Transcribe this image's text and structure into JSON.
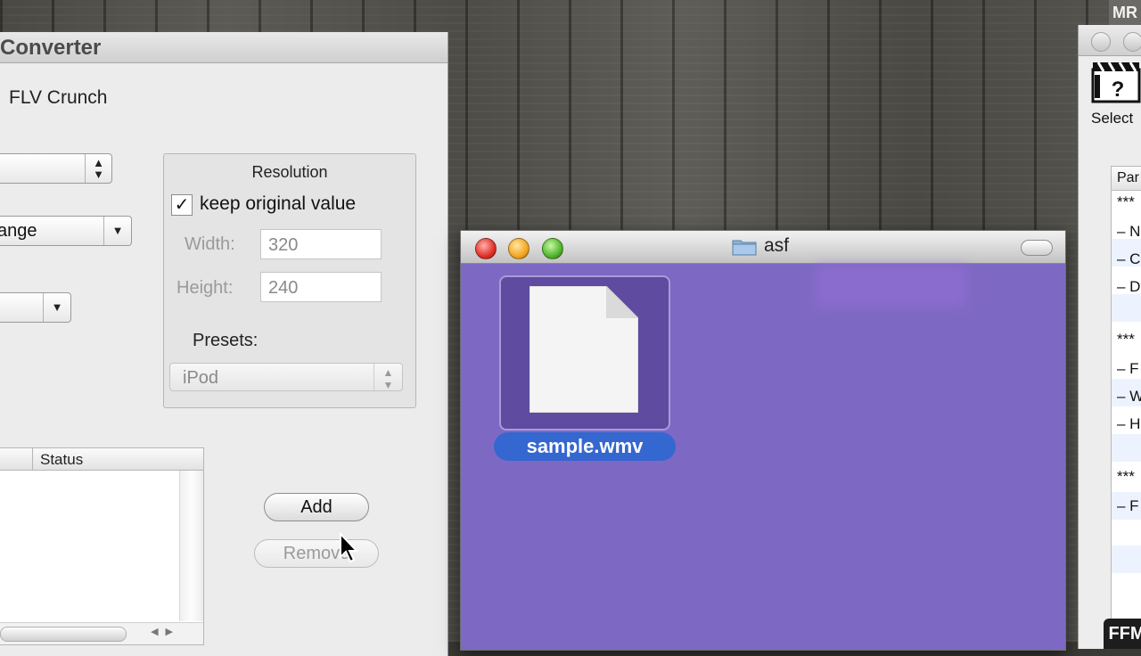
{
  "badge_mr": "MR",
  "converter": {
    "title": "Converter",
    "subtitle": "FLV Crunch",
    "popup2_text": "ange",
    "resolution": {
      "title": "Resolution",
      "keep_original_checked": true,
      "keep_original_label": "keep original value",
      "width_label": "Width:",
      "width_value": "320",
      "height_label": "Height:",
      "height_value": "240",
      "presets_label": "Presets:",
      "preset_value": "iPod"
    },
    "table": {
      "status_header": "Status"
    },
    "add_button": "Add",
    "remove_button": "Remove"
  },
  "finder": {
    "title": "asf",
    "file_name": "sample.wmv"
  },
  "right_window": {
    "toolbar_label": "Select",
    "table_header": "Par",
    "rows": [
      "***",
      "– N",
      "– C",
      "– D",
      "***",
      "– F",
      "– W",
      "– H",
      "***",
      "– F"
    ]
  },
  "badge_ffm": "FFM",
  "glyphs": {
    "checkmark": "✓",
    "stepper": "▲\n▼",
    "down": "▼"
  },
  "colors": {
    "finder_background": "#7d69c3",
    "selection": "#3567d0"
  }
}
